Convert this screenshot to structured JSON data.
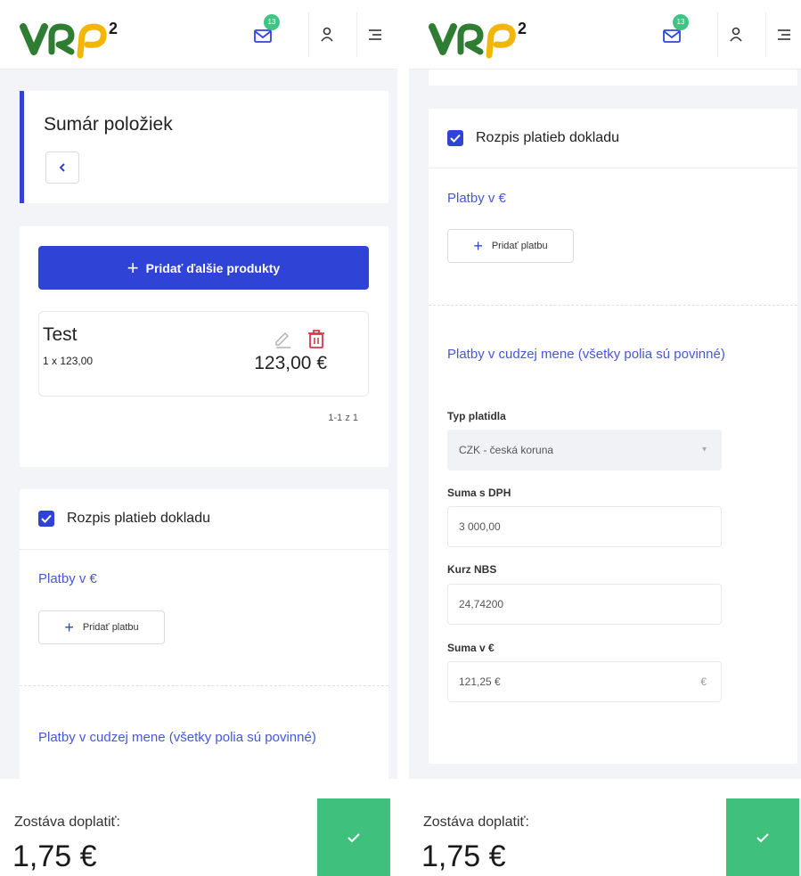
{
  "header": {
    "logo_text": "VRP²",
    "mail_badge": "13",
    "icons": [
      "mail-icon",
      "user-icon",
      "menu-icon"
    ]
  },
  "summary": {
    "title": "Sumár položiek",
    "back_icon": "chevron-left-icon"
  },
  "products": {
    "add_button": "Pridať ďalšie produkty",
    "items": [
      {
        "name": "Test",
        "qty_price": "1 x 123,00",
        "total": "123,00 €"
      }
    ],
    "pagination": "1-1 z 1"
  },
  "payments": {
    "checkbox_label": "Rozpis platieb dokladu",
    "checked": true,
    "eur_section": "Platby v €",
    "add_payment": "Pridať platbu",
    "foreign_section": "Platby v cudzej mene (všetky polia sú povinné)",
    "fields": {
      "type_label": "Typ platidla",
      "type_value": "CZK - česká koruna",
      "sum_vat_label": "Suma s DPH",
      "sum_vat_value": "3 000,00",
      "rate_label": "Kurz NBS",
      "rate_value": "24,74200",
      "sum_eur_label": "Suma v €",
      "sum_eur_value": "121,25 €",
      "sum_eur_suffix": "€"
    }
  },
  "footer": {
    "remaining_label": "Zostáva doplatiť:",
    "remaining_amount": "1,75 €",
    "confirm_icon": "check-icon"
  },
  "colors": {
    "primary": "#2f44d6",
    "link": "#4657d8",
    "success": "#3fc07d",
    "danger": "#e0344b",
    "logo_green": "#2e7d32",
    "logo_yellow": "#f2b705"
  }
}
